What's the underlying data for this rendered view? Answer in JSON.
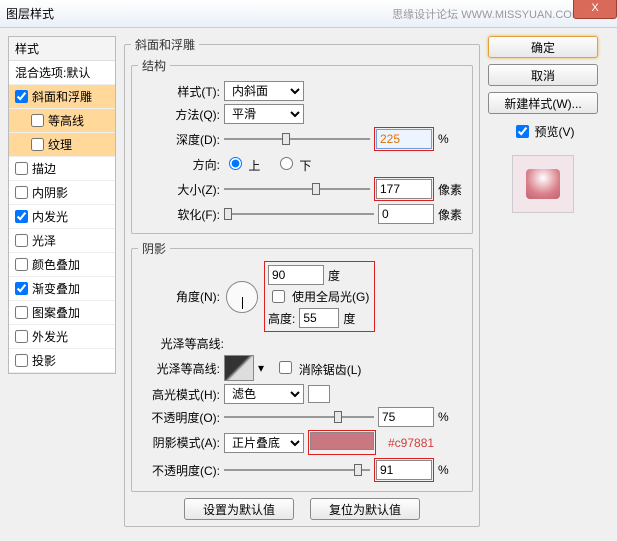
{
  "window": {
    "title": "图层样式",
    "watermark": "思缘设计论坛  WWW.MISSYUAN.COM",
    "close": "X"
  },
  "left": {
    "header": "样式",
    "blending": "混合选项:默认",
    "items": [
      {
        "label": "斜面和浮雕",
        "checked": true,
        "selected": true,
        "sub": false
      },
      {
        "label": "等高线",
        "checked": false,
        "selected": true,
        "sub": true
      },
      {
        "label": "纹理",
        "checked": false,
        "selected": true,
        "sub": true
      },
      {
        "label": "描边",
        "checked": false,
        "selected": false,
        "sub": false
      },
      {
        "label": "内阴影",
        "checked": false,
        "selected": false,
        "sub": false
      },
      {
        "label": "内发光",
        "checked": true,
        "selected": false,
        "sub": false
      },
      {
        "label": "光泽",
        "checked": false,
        "selected": false,
        "sub": false
      },
      {
        "label": "颜色叠加",
        "checked": false,
        "selected": false,
        "sub": false
      },
      {
        "label": "渐变叠加",
        "checked": true,
        "selected": false,
        "sub": false
      },
      {
        "label": "图案叠加",
        "checked": false,
        "selected": false,
        "sub": false
      },
      {
        "label": "外发光",
        "checked": false,
        "selected": false,
        "sub": false
      },
      {
        "label": "投影",
        "checked": false,
        "selected": false,
        "sub": false
      }
    ]
  },
  "panel": {
    "title": "斜面和浮雕",
    "structure": {
      "legend": "结构",
      "style_l": "样式(T):",
      "style_v": "内斜面",
      "tech_l": "方法(Q):",
      "tech_v": "平滑",
      "depth_l": "深度(D):",
      "depth_v": "225",
      "depth_u": "%",
      "dir_l": "方向:",
      "dir_up": "上",
      "dir_down": "下",
      "size_l": "大小(Z):",
      "size_v": "177",
      "size_u": "像素",
      "soft_l": "软化(F):",
      "soft_v": "0",
      "soft_u": "像素"
    },
    "shading": {
      "legend": "阴影",
      "angle_l": "角度(N):",
      "angle_v": "90",
      "angle_u": "度",
      "global_l": "使用全局光(G)",
      "alt_l": "高度:",
      "alt_v": "55",
      "alt_u": "度",
      "gloss_l": "光泽等高线:",
      "aa_l": "消除锯齿(L)",
      "hmode_l": "高光模式(H):",
      "hmode_v": "滤色",
      "hopac_l": "不透明度(O):",
      "hopac_v": "75",
      "hopac_u": "%",
      "smode_l": "阴影模式(A):",
      "smode_v": "正片叠底",
      "sopac_l": "不透明度(C):",
      "sopac_v": "91",
      "sopac_u": "%",
      "hex": "#c97881"
    },
    "btn_default": "设置为默认值",
    "btn_reset": "复位为默认值"
  },
  "right": {
    "ok": "确定",
    "cancel": "取消",
    "newstyle": "新建样式(W)...",
    "preview_l": "预览(V)"
  }
}
